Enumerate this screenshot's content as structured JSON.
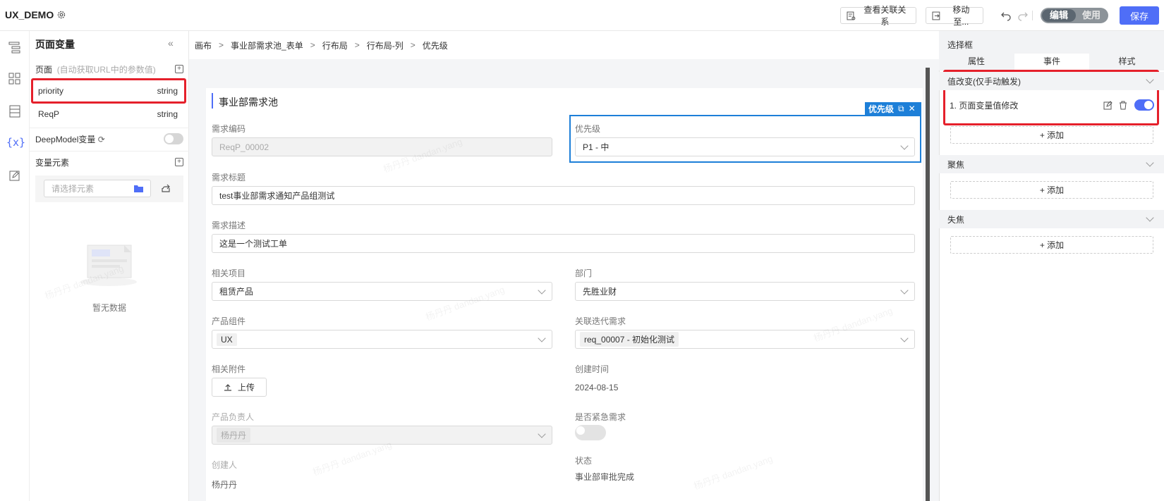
{
  "app": {
    "title": "UX_DEMO"
  },
  "toolbar": {
    "view_relations": "查看关联关系",
    "move_to": "移动至...",
    "mode_edit": "编辑",
    "mode_use": "使用",
    "save": "保存"
  },
  "var_panel": {
    "title": "页面变量",
    "page_label": "页面",
    "page_hint": "(自动获取URL中的参数值)",
    "vars": [
      {
        "name": "priority",
        "type": "string"
      },
      {
        "name": "ReqP",
        "type": "string"
      }
    ],
    "deepmodel_label": "DeepModel变量",
    "element_label": "变量元素",
    "element_placeholder": "请选择元素",
    "empty_text": "暂无数据"
  },
  "breadcrumb": [
    "画布",
    "事业部需求池_表单",
    "行布局",
    "行布局-列",
    "优先级"
  ],
  "form": {
    "title": "事业部需求池",
    "selected_badge": "优先级",
    "fields": {
      "req_code": {
        "label": "需求编码",
        "value": "ReqP_00002"
      },
      "priority": {
        "label": "优先级",
        "value": "P1 - 中"
      },
      "req_title": {
        "label": "需求标题",
        "value": "test事业部需求通知产品组测试"
      },
      "req_desc": {
        "label": "需求描述",
        "value": "这是一个测试工单"
      },
      "project": {
        "label": "相关项目",
        "value": "租赁产品"
      },
      "dept": {
        "label": "部门",
        "value": "先胜业财"
      },
      "component": {
        "label": "产品组件",
        "value": "UX"
      },
      "iteration": {
        "label": "关联迭代需求",
        "value": "req_00007 - 初始化测试"
      },
      "attachment": {
        "label": "相关附件",
        "button": "上传"
      },
      "created_time": {
        "label": "创建时间",
        "value": "2024-08-15"
      },
      "owner": {
        "label": "产品负责人",
        "value": "杨丹丹"
      },
      "urgent": {
        "label": "是否紧急需求"
      },
      "creator": {
        "label": "创建人",
        "value": "杨丹丹"
      },
      "status": {
        "label": "状态",
        "value": "事业部审批完成"
      }
    }
  },
  "right_panel": {
    "title": "选择框",
    "tabs": [
      "属性",
      "事件",
      "样式"
    ],
    "active_tab": "事件",
    "sections": [
      {
        "title": "值改变(仅手动触发)",
        "actions": [
          {
            "label": "1. 页面变量值修改",
            "enabled": true
          }
        ],
        "add": "+ 添加"
      },
      {
        "title": "聚焦",
        "actions": [],
        "add": "+ 添加"
      },
      {
        "title": "失焦",
        "actions": [],
        "add": "+ 添加"
      }
    ]
  },
  "watermark": "杨丹丹 dandan.yang",
  "colors": {
    "accent": "#4f6ef7",
    "highlight": "#e5202b",
    "selection": "#1d7fd8"
  }
}
